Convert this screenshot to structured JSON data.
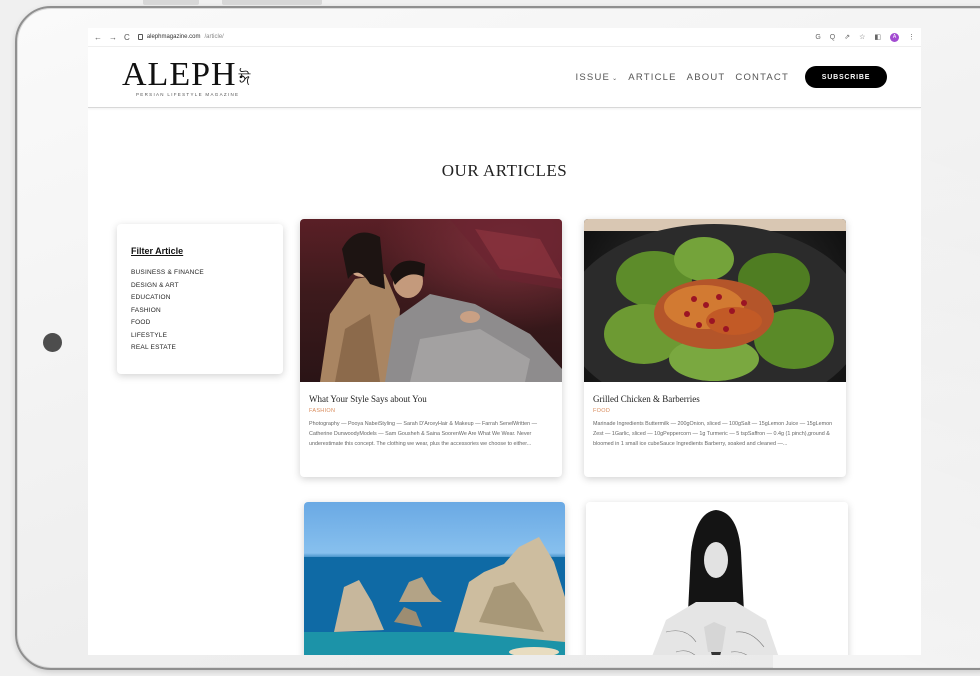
{
  "browser": {
    "nav_back": "←",
    "nav_forward": "→",
    "nav_reload": "C",
    "url_domain": "alephmagazine.com",
    "url_path": "/article/",
    "tool_icons": [
      "G",
      "Q",
      "⇗",
      "☆",
      "◧"
    ],
    "profile_initial": "A",
    "menu": "⋮"
  },
  "site": {
    "logo": "ALEPH",
    "logo_mark": "ঈ",
    "tagline": "PERSIAN LIFESTYLE MAGAZINE",
    "nav": [
      {
        "label": "ISSUE",
        "has_caret": true
      },
      {
        "label": "ARTICLE"
      },
      {
        "label": "ABOUT"
      },
      {
        "label": "CONTACT"
      }
    ],
    "caret": "⌄",
    "subscribe_label": "SUBSCRIBE"
  },
  "page": {
    "heading": "OUR ARTICLES"
  },
  "filter": {
    "title": "Filter Article",
    "items": [
      "BUSINESS & FINANCE",
      "DESIGN & ART",
      "EDUCATION",
      "FASHION",
      "FOOD",
      "LIFESTYLE",
      "REAL ESTATE"
    ]
  },
  "articles": [
    {
      "title": "What Your Style Says about You",
      "category": "FASHION",
      "excerpt": "Photography — Pooya NabeiStyling — Sarah D'ArceyHair & Makeup — Farrah SenelWritten — Catherine DunwoodyModels — Sam Gousheh & Saina SoorenWe Are What We Wear. Never underestimate this concept. The clothing we wear, plus the accessories we choose to either..."
    },
    {
      "title": "Grilled Chicken & Barberries",
      "category": "FOOD",
      "excerpt": "Marinade Ingredients Buttermilk — 200gOnion, sliced — 100gSalt — 15gLemon Juice — 15gLemon Zest — 1Garlic, sliced — 10gPeppercorn — 1g Turmeric — 5 tspSaffron — 0.4g (1 pinch),ground & bloomed in 1 small ice cubeSauce Ingredients Barberry, soaked and cleaned —..."
    }
  ],
  "colors": {
    "accent_category": "#d88a5a",
    "subscribe_bg": "#000000",
    "profile": "#a24bd1"
  }
}
